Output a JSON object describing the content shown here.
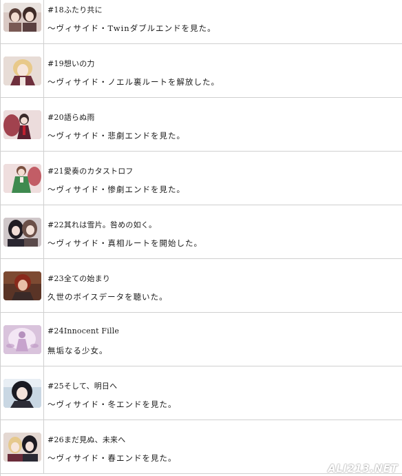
{
  "achievements": [
    {
      "title": "#18ふたり共に",
      "desc": "～ヴィサイド・Twinダブルエンドを見た。",
      "thumb_icon": "two-girls-portrait-icon"
    },
    {
      "title": "#19想いの力",
      "desc": "～ヴィサイド・ノエル裏ルートを解放した。",
      "thumb_icon": "blonde-girl-portrait-icon"
    },
    {
      "title": "#20語らぬ雨",
      "desc": "～ヴィサイド・悲劇エンドを見た。",
      "thumb_icon": "girl-in-blood-rain-icon"
    },
    {
      "title": "#21愛奏のカタストロフ",
      "desc": "～ヴィサイド・惨劇エンドを見た。",
      "thumb_icon": "girl-green-dress-icon"
    },
    {
      "title": "#22其れは雪片。咎めの如く。",
      "desc": "～ヴィサイド・真相ルートを開始した。",
      "thumb_icon": "two-girls-dark-icon"
    },
    {
      "title": "#23全ての始まり",
      "desc": "久世のボイスデータを聴いた。",
      "thumb_icon": "red-haired-boy-icon"
    },
    {
      "title": "#24Innocent Fille",
      "desc": "無垢なる少女。",
      "thumb_icon": "pink-light-silhouette-icon"
    },
    {
      "title": "#25そして、明日へ",
      "desc": "～ヴィサイド・冬エンドを見た。",
      "thumb_icon": "black-haired-girl-icon"
    },
    {
      "title": "#26まだ見ぬ、未来へ",
      "desc": "～ヴィサイド・春エンドを見た。",
      "thumb_icon": "two-girls-spring-icon"
    }
  ],
  "watermark": "ALI213.NET"
}
